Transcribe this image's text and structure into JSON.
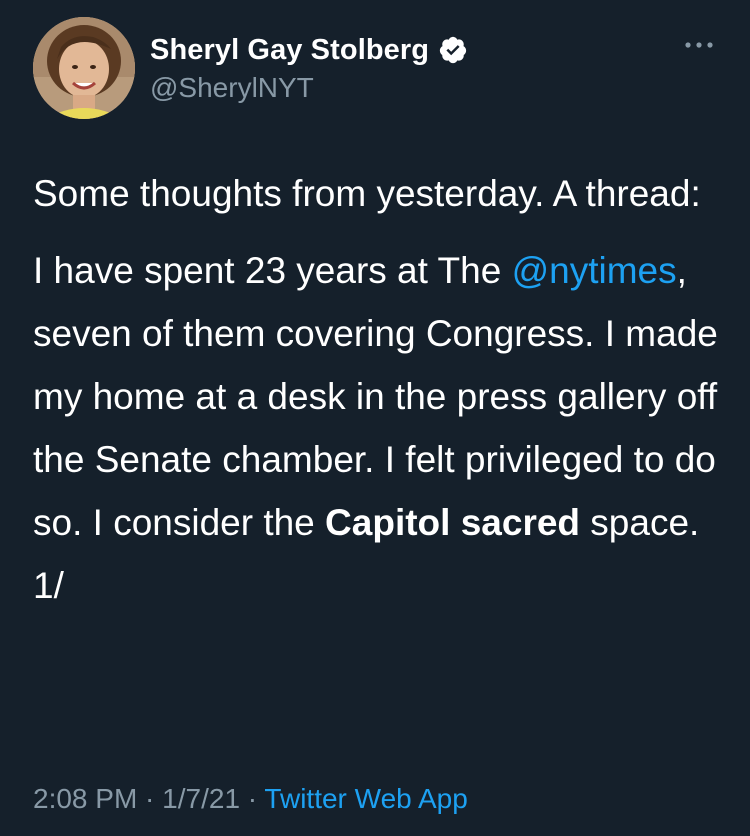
{
  "author": {
    "name": "Sheryl Gay Stolberg",
    "handle": "@SherylNYT",
    "verified": true
  },
  "tweet": {
    "para1": "Some thoughts from yesterday. A thread:",
    "para2_pre": "I have spent 23 years at The ",
    "mention": "@nytimes",
    "para2_mid": ", seven of them covering Congress. I made my home at a desk in the press gallery off the Senate chamber. I felt privileged to do so. I consider the ",
    "bold": "Capitol sacred",
    "para2_post": " space.",
    "thread_marker": "1/"
  },
  "meta": {
    "time": "2:08 PM",
    "sep1": " · ",
    "date": "1/7/21",
    "sep2": " · ",
    "source": "Twitter Web App"
  },
  "colors": {
    "background": "#15202b",
    "text": "#ffffff",
    "secondary": "#8899a6",
    "accent": "#1da1f2"
  },
  "icons": {
    "verified": "verified-badge-icon",
    "more": "more-options-icon"
  }
}
